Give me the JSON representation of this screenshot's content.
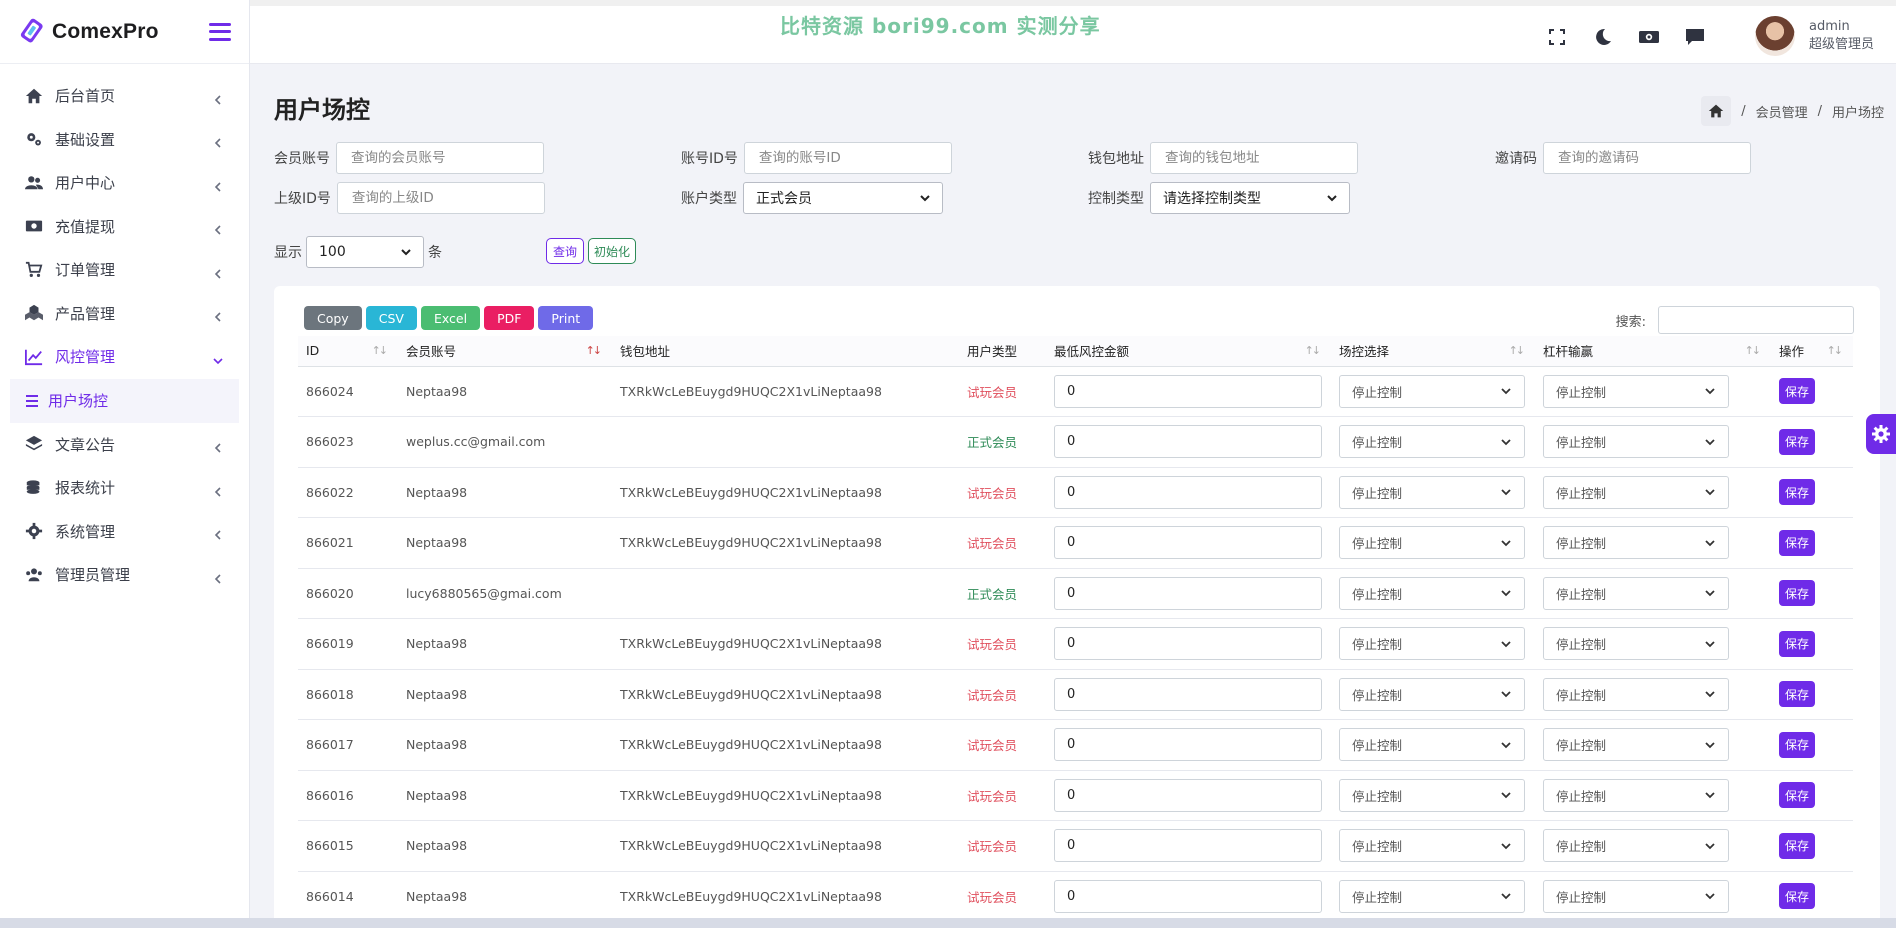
{
  "brand": {
    "name": "ComexPro"
  },
  "watermark": "比特资源 bori99.com 实测分享",
  "user": {
    "name": "admin",
    "role": "超级管理员"
  },
  "sidebar": {
    "items": [
      {
        "label": "后台首页",
        "icon": "home-icon"
      },
      {
        "label": "基础设置",
        "icon": "cogs-icon"
      },
      {
        "label": "用户中心",
        "icon": "users-icon"
      },
      {
        "label": "充值提现",
        "icon": "money-icon"
      },
      {
        "label": "订单管理",
        "icon": "cart-icon"
      },
      {
        "label": "产品管理",
        "icon": "boxes-icon"
      },
      {
        "label": "风控管理",
        "icon": "chart-line-icon",
        "active": true
      },
      {
        "label": "文章公告",
        "icon": "layers-icon"
      },
      {
        "label": "报表统计",
        "icon": "coins-icon"
      },
      {
        "label": "系统管理",
        "icon": "gear-icon"
      },
      {
        "label": "管理员管理",
        "icon": "user-group-icon"
      }
    ],
    "sub_active": "用户场控"
  },
  "page": {
    "title": "用户场控",
    "breadcrumb": [
      "会员管理",
      "用户场控"
    ]
  },
  "filters": {
    "member_account": {
      "label": "会员账号",
      "placeholder": "查询的会员账号"
    },
    "account_id": {
      "label": "账号ID号",
      "placeholder": "查询的账号ID"
    },
    "wallet": {
      "label": "钱包地址",
      "placeholder": "查询的钱包地址"
    },
    "invite": {
      "label": "邀请码",
      "placeholder": "查询的邀请码"
    },
    "parent_id": {
      "label": "上级ID号",
      "placeholder": "查询的上级ID"
    },
    "account_type": {
      "label": "账户类型",
      "value": "正式会员"
    },
    "control_type": {
      "label": "控制类型",
      "value": "请选择控制类型"
    },
    "show_label": "显示",
    "show_value": "100",
    "show_unit": "条",
    "query_label": "查询",
    "init_label": "初始化"
  },
  "toolbar": {
    "buttons": [
      {
        "label": "Copy",
        "color": "#6c757d"
      },
      {
        "label": "CSV",
        "color": "#29b6d6"
      },
      {
        "label": "Excel",
        "color": "#4bbd72"
      },
      {
        "label": "PDF",
        "color": "#ea1e63"
      },
      {
        "label": "Print",
        "color": "#6f6ae8"
      }
    ],
    "search_label": "搜索:"
  },
  "table": {
    "columns": [
      "ID",
      "会员账号",
      "钱包地址",
      "用户类型",
      "最低风控金额",
      "场控选择",
      "杠杆输赢",
      "操作"
    ],
    "rows": [
      {
        "id": "866024",
        "account": "Neptaa98",
        "wallet": "TXRkWcLeBEuygd9HUQC2X1vLiNeptaa98",
        "type": "试玩会员",
        "trial": true,
        "amount": "0",
        "control": "停止控制",
        "leverage": "停止控制",
        "action": "保存"
      },
      {
        "id": "866023",
        "account": "weplus.cc@gmail.com",
        "wallet": "",
        "type": "正式会员",
        "trial": false,
        "amount": "0",
        "control": "停止控制",
        "leverage": "停止控制",
        "action": "保存"
      },
      {
        "id": "866022",
        "account": "Neptaa98",
        "wallet": "TXRkWcLeBEuygd9HUQC2X1vLiNeptaa98",
        "type": "试玩会员",
        "trial": true,
        "amount": "0",
        "control": "停止控制",
        "leverage": "停止控制",
        "action": "保存"
      },
      {
        "id": "866021",
        "account": "Neptaa98",
        "wallet": "TXRkWcLeBEuygd9HUQC2X1vLiNeptaa98",
        "type": "试玩会员",
        "trial": true,
        "amount": "0",
        "control": "停止控制",
        "leverage": "停止控制",
        "action": "保存"
      },
      {
        "id": "866020",
        "account": "lucy6880565@gmai.com",
        "wallet": "",
        "type": "正式会员",
        "trial": false,
        "amount": "0",
        "control": "停止控制",
        "leverage": "停止控制",
        "action": "保存"
      },
      {
        "id": "866019",
        "account": "Neptaa98",
        "wallet": "TXRkWcLeBEuygd9HUQC2X1vLiNeptaa98",
        "type": "试玩会员",
        "trial": true,
        "amount": "0",
        "control": "停止控制",
        "leverage": "停止控制",
        "action": "保存"
      },
      {
        "id": "866018",
        "account": "Neptaa98",
        "wallet": "TXRkWcLeBEuygd9HUQC2X1vLiNeptaa98",
        "type": "试玩会员",
        "trial": true,
        "amount": "0",
        "control": "停止控制",
        "leverage": "停止控制",
        "action": "保存"
      },
      {
        "id": "866017",
        "account": "Neptaa98",
        "wallet": "TXRkWcLeBEuygd9HUQC2X1vLiNeptaa98",
        "type": "试玩会员",
        "trial": true,
        "amount": "0",
        "control": "停止控制",
        "leverage": "停止控制",
        "action": "保存"
      },
      {
        "id": "866016",
        "account": "Neptaa98",
        "wallet": "TXRkWcLeBEuygd9HUQC2X1vLiNeptaa98",
        "type": "试玩会员",
        "trial": true,
        "amount": "0",
        "control": "停止控制",
        "leverage": "停止控制",
        "action": "保存"
      },
      {
        "id": "866015",
        "account": "Neptaa98",
        "wallet": "TXRkWcLeBEuygd9HUQC2X1vLiNeptaa98",
        "type": "试玩会员",
        "trial": true,
        "amount": "0",
        "control": "停止控制",
        "leverage": "停止控制",
        "action": "保存"
      },
      {
        "id": "866014",
        "account": "Neptaa98",
        "wallet": "TXRkWcLeBEuygd9HUQC2X1vLiNeptaa98",
        "type": "试玩会员",
        "trial": true,
        "amount": "0",
        "control": "停止控制",
        "leverage": "停止控制",
        "action": "保存"
      }
    ]
  },
  "colors": {
    "accent": "#6f2be8",
    "trial": "#e0505e",
    "formal": "#2e8b57"
  }
}
